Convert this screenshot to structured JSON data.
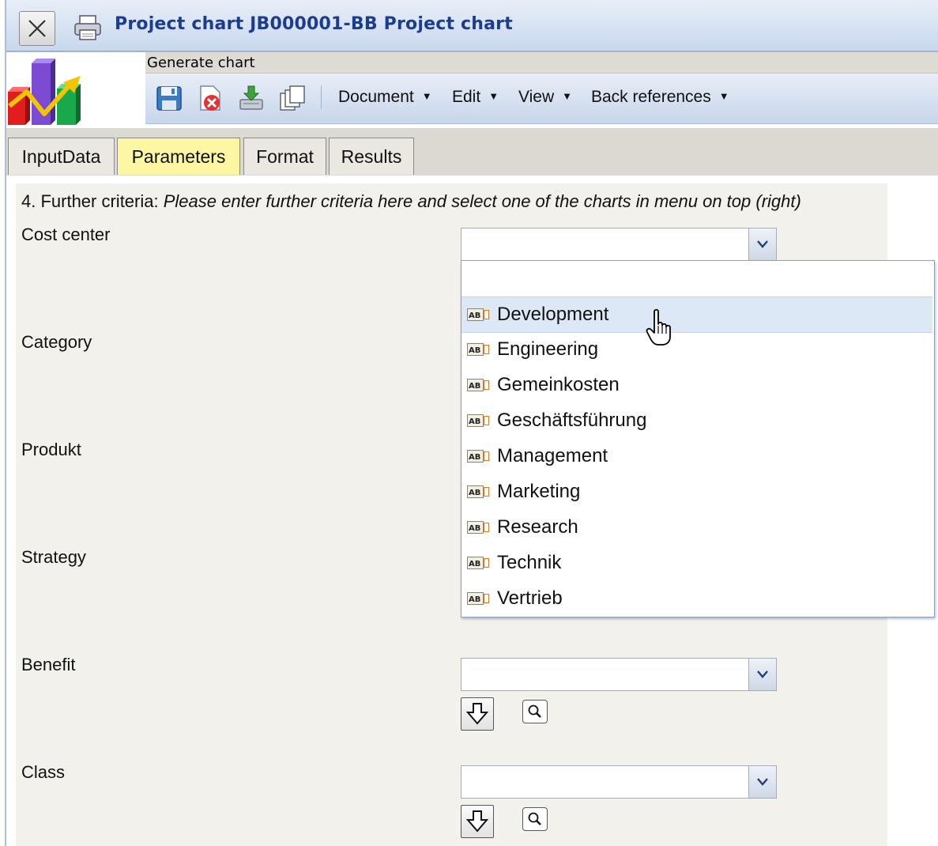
{
  "window": {
    "title": "Project chart JB000001-BB Project chart"
  },
  "toolbar": {
    "generate_label": "Generate chart",
    "menus": [
      "Document",
      "Edit",
      "View",
      "Back references"
    ]
  },
  "tabs": [
    {
      "label": "InputData",
      "active": false
    },
    {
      "label": "Parameters",
      "active": true
    },
    {
      "label": "Format",
      "active": false
    },
    {
      "label": "Results",
      "active": false
    }
  ],
  "criteria": {
    "prefix": "4. Further criteria: ",
    "hint": "Please enter further criteria here and select one of the charts in menu on top (right)"
  },
  "fields": {
    "cost_center": {
      "label": "Cost center",
      "value": ""
    },
    "category": {
      "label": "Category"
    },
    "produkt": {
      "label": "Produkt"
    },
    "strategy": {
      "label": "Strategy"
    },
    "benefit": {
      "label": "Benefit",
      "value": ""
    },
    "class": {
      "label": "Class",
      "value": ""
    }
  },
  "dropdown": {
    "hovered": "Development",
    "options": [
      "Development",
      "Engineering",
      "Gemeinkosten",
      "Geschäftsführung",
      "Management",
      "Marketing",
      "Research",
      "Technik",
      "Vertrieb"
    ]
  },
  "colors": {
    "title_text": "#1c3d8f",
    "active_tab": "#fdf7a4",
    "content_bg": "#f2f1ec",
    "hover_row": "#dde8f7"
  }
}
